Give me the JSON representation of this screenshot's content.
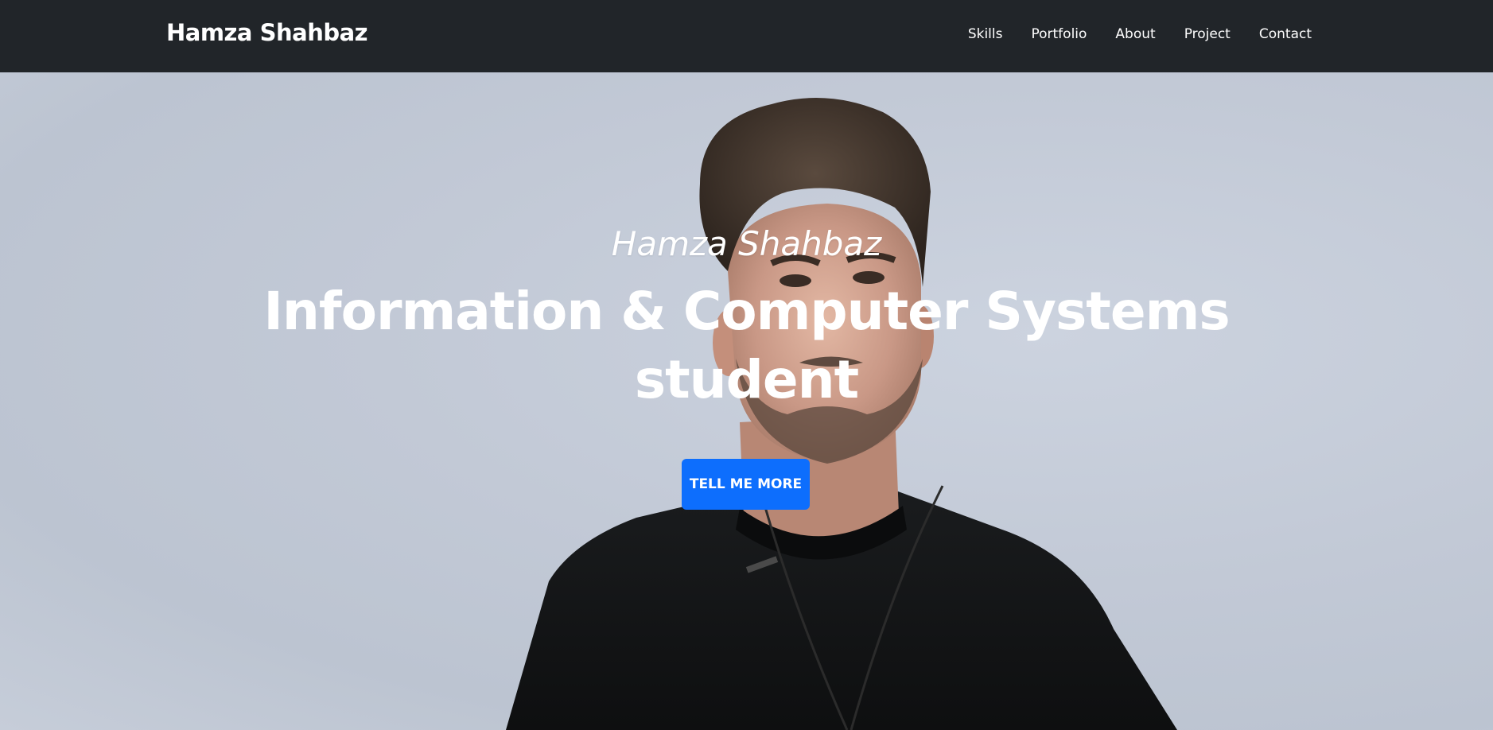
{
  "navbar": {
    "brand": "Hamza Shahbaz",
    "links": [
      "Skills",
      "Portfolio",
      "About",
      "Project",
      "Contact"
    ]
  },
  "hero": {
    "subheading": "Hamza Shahbaz",
    "heading_line_1": "Information & Computer Systems",
    "heading_line_2": "student",
    "button_label": "TELL ME MORE"
  },
  "colors": {
    "navbar_bg": "#212529",
    "button_bg": "#0d6efd",
    "hero_bg": "#c4cbd7",
    "text": "#ffffff"
  }
}
